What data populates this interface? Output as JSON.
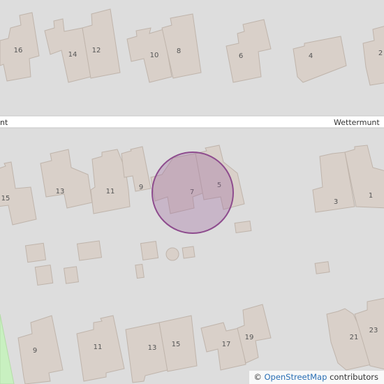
{
  "street_name": "Wettermunt",
  "street_name_partial": "nt",
  "house_numbers": {
    "n16": "16",
    "n14": "14",
    "n12": "12",
    "n10": "10",
    "n8": "8",
    "n6": "6",
    "n4": "4",
    "n2": "2",
    "n15": "15",
    "n13": "13",
    "n11": "11",
    "n9": "9",
    "n7": "7",
    "n5": "5",
    "n3": "3",
    "n1": "1",
    "s9": "9",
    "s11": "11",
    "s13": "13",
    "s15": "15",
    "s17": "17",
    "s19": "19",
    "s21": "21",
    "s23": "23"
  },
  "attribution": {
    "symbol": "©",
    "link_text": "OpenStreetMap",
    "suffix": "contributors"
  },
  "colors": {
    "background": "#dddddd",
    "building": "#d9d0c9",
    "marker": "#8e4c8e",
    "park": "#c8f0c0"
  }
}
